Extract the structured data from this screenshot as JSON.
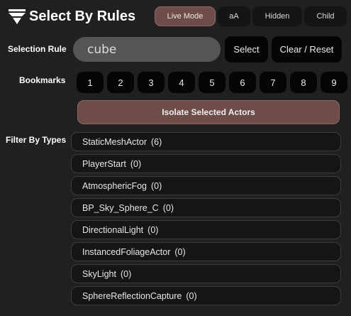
{
  "header": {
    "title": "Select By Rules",
    "toggles": [
      "Live Mode",
      "aA",
      "Hidden",
      "Child"
    ]
  },
  "selection": {
    "label": "Selection Rule",
    "value": "cube",
    "select_label": "Select",
    "clear_label": "Clear / Reset"
  },
  "bookmarks": {
    "label": "Bookmarks",
    "items": [
      "1",
      "2",
      "3",
      "4",
      "5",
      "6",
      "7",
      "8",
      "9"
    ]
  },
  "isolate_label": "Isolate Selected Actors",
  "filter": {
    "label": "Filter By Types",
    "types": [
      {
        "name": "StaticMeshActor",
        "count": "(6)"
      },
      {
        "name": "PlayerStart",
        "count": "(0)"
      },
      {
        "name": "AtmosphericFog",
        "count": "(0)"
      },
      {
        "name": "BP_Sky_Sphere_C",
        "count": "(0)"
      },
      {
        "name": "DirectionalLight",
        "count": "(0)"
      },
      {
        "name": "InstancedFoliageActor",
        "count": "(0)"
      },
      {
        "name": "SkyLight",
        "count": "(0)"
      },
      {
        "name": "SphereReflectionCapture",
        "count": "(0)"
      }
    ]
  },
  "colors": {
    "background": "#202020",
    "accent_active": "#6e4c4a",
    "button_black": "#050505",
    "input_fill": "#555555"
  }
}
